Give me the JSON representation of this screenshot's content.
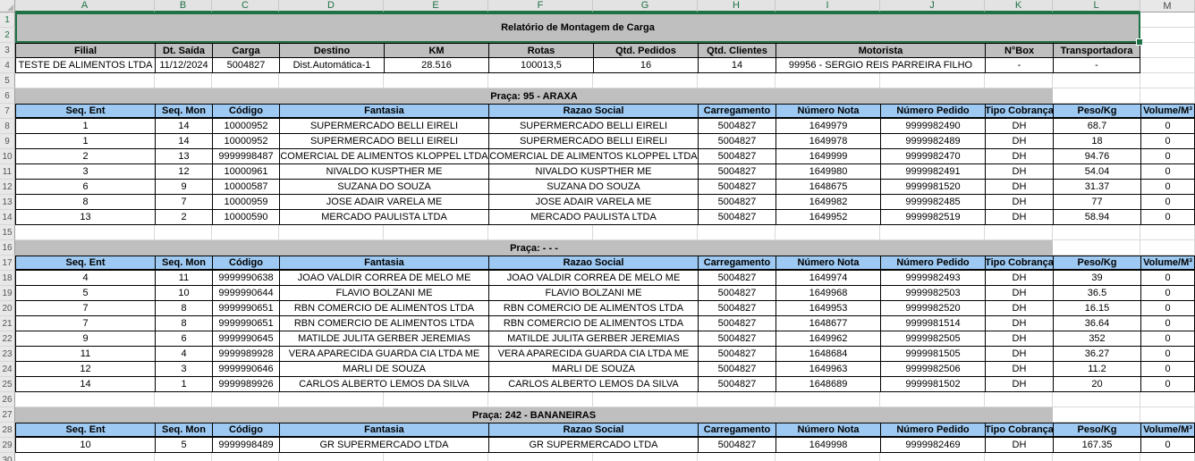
{
  "title": "Relatório de Montagem de Carga",
  "column_headers": [
    "A",
    "B",
    "C",
    "D",
    "E",
    "F",
    "G",
    "H",
    "I",
    "J",
    "K",
    "L",
    "M"
  ],
  "selected_columns": [
    "A",
    "B",
    "C",
    "D",
    "E",
    "F",
    "G",
    "H",
    "I",
    "J",
    "K",
    "L"
  ],
  "summary": {
    "headers": [
      "Filial",
      "Dt. Saída",
      "Carga",
      "Destino",
      "KM",
      "Rotas",
      "Qtd. Pedidos",
      "Qtd. Clientes",
      "Motorista",
      "N°Box",
      "Transportadora"
    ],
    "values": [
      "TESTE DE ALIMENTOS LTDA",
      "11/12/2024",
      "5004827",
      "Dist.Automática-1",
      "28.516",
      "100013,5",
      "16",
      "14",
      "99956 - SERGIO REIS PARREIRA FILHO",
      "-",
      "-"
    ]
  },
  "detail_headers": [
    "Seq. Ent",
    "Seq. Mon",
    "Código",
    "Fantasia",
    "Razao Social",
    "Carregamento",
    "Número Nota",
    "Número Pedido",
    "Tipo Cobrança",
    "Peso/Kg",
    "Volume/M³"
  ],
  "sections": [
    {
      "title": "Praça: 95 - ARAXA",
      "rows": [
        [
          "1",
          "14",
          "10000952",
          "SUPERMERCADO BELLI EIRELI",
          "SUPERMERCADO BELLI EIRELI",
          "5004827",
          "1649979",
          "9999982490",
          "DH",
          "68.7",
          "0"
        ],
        [
          "1",
          "14",
          "10000952",
          "SUPERMERCADO BELLI EIRELI",
          "SUPERMERCADO BELLI EIRELI",
          "5004827",
          "1649978",
          "9999982489",
          "DH",
          "18",
          "0"
        ],
        [
          "2",
          "13",
          "9999998487",
          "COMERCIAL DE ALIMENTOS KLOPPEL LTDA",
          "COMERCIAL DE ALIMENTOS KLOPPEL LTDA",
          "5004827",
          "1649999",
          "9999982470",
          "DH",
          "94.76",
          "0"
        ],
        [
          "3",
          "12",
          "10000961",
          "NIVALDO KUSPTHER ME",
          "NIVALDO KUSPTHER ME",
          "5004827",
          "1649980",
          "9999982491",
          "DH",
          "54.04",
          "0"
        ],
        [
          "6",
          "9",
          "10000587",
          "SUZANA DO SOUZA",
          "SUZANA DO SOUZA",
          "5004827",
          "1648675",
          "9999981520",
          "DH",
          "31.37",
          "0"
        ],
        [
          "8",
          "7",
          "10000959",
          "JOSE ADAIR VARELA ME",
          "JOSE ADAIR VARELA ME",
          "5004827",
          "1649982",
          "9999982485",
          "DH",
          "77",
          "0"
        ],
        [
          "13",
          "2",
          "10000590",
          "MERCADO PAULISTA LTDA",
          "MERCADO PAULISTA LTDA",
          "5004827",
          "1649952",
          "9999982519",
          "DH",
          "58.94",
          "0"
        ]
      ]
    },
    {
      "title": "Praça: - - -",
      "rows": [
        [
          "4",
          "11",
          "9999990638",
          "JOAO VALDIR CORREA DE MELO ME",
          "JOAO VALDIR CORREA DE MELO ME",
          "5004827",
          "1649974",
          "9999982493",
          "DH",
          "39",
          "0"
        ],
        [
          "5",
          "10",
          "9999990644",
          "FLAVIO BOLZANI ME",
          "FLAVIO BOLZANI ME",
          "5004827",
          "1649968",
          "9999982503",
          "DH",
          "36.5",
          "0"
        ],
        [
          "7",
          "8",
          "9999990651",
          "RBN COMERCIO DE ALIMENTOS LTDA",
          "RBN COMERCIO DE ALIMENTOS LTDA",
          "5004827",
          "1649953",
          "9999982520",
          "DH",
          "16.15",
          "0"
        ],
        [
          "7",
          "8",
          "9999990651",
          "RBN COMERCIO DE ALIMENTOS LTDA",
          "RBN COMERCIO DE ALIMENTOS LTDA",
          "5004827",
          "1648677",
          "9999981514",
          "DH",
          "36.64",
          "0"
        ],
        [
          "9",
          "6",
          "9999990645",
          "MATILDE JULITA GERBER JEREMIAS",
          "MATILDE JULITA GERBER JEREMIAS",
          "5004827",
          "1649962",
          "9999982505",
          "DH",
          "352",
          "0"
        ],
        [
          "11",
          "4",
          "9999989928",
          "VERA APARECIDA GUARDA CIA LTDA ME",
          "VERA APARECIDA GUARDA CIA LTDA ME",
          "5004827",
          "1648684",
          "9999981505",
          "DH",
          "36.27",
          "0"
        ],
        [
          "12",
          "3",
          "9999990646",
          "MARLI DE SOUZA",
          "MARLI DE SOUZA",
          "5004827",
          "1649963",
          "9999982506",
          "DH",
          "11.2",
          "0"
        ],
        [
          "14",
          "1",
          "9999989926",
          "CARLOS ALBERTO LEMOS DA SILVA",
          "CARLOS ALBERTO LEMOS DA SILVA",
          "5004827",
          "1648689",
          "9999981502",
          "DH",
          "20",
          "0"
        ]
      ]
    },
    {
      "title": "Praça: 242 - BANANEIRAS",
      "rows": [
        [
          "10",
          "5",
          "9999998489",
          "GR SUPERMERCADO LTDA",
          "GR SUPERMERCADO LTDA",
          "5004827",
          "1649998",
          "9999982469",
          "DH",
          "167.35",
          "0"
        ]
      ]
    }
  ],
  "colors": {
    "selection_green": "#1F7246",
    "header_fill_gray": "#BFBFBF",
    "detail_header_blue": "#9DC9F2",
    "cell_border": "#000000",
    "gridline": "#D9D9D9",
    "gutter_bg": "#E8E8E8"
  }
}
